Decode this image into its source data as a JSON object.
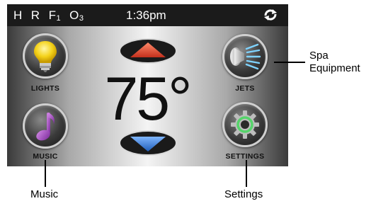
{
  "status_bar": {
    "indicators": [
      {
        "text": "H",
        "sub": ""
      },
      {
        "text": "R",
        "sub": ""
      },
      {
        "text": "F",
        "sub": "1"
      },
      {
        "text": "O",
        "sub": "3"
      }
    ],
    "time": "1:36pm",
    "sync_icon": "sync-icon"
  },
  "buttons": {
    "lights": {
      "label": "LIGHTS",
      "icon": "lightbulb-icon"
    },
    "music": {
      "label": "MUSIC",
      "icon": "music-note-icon"
    },
    "jets": {
      "label": "JETS",
      "icon": "jets-icon"
    },
    "settings": {
      "label": "SETTINGS",
      "icon": "gear-icon"
    }
  },
  "temperature": {
    "value": "75°"
  },
  "arrows": {
    "up": {
      "icon": "up-arrow-icon",
      "color": "#e0523a"
    },
    "down": {
      "icon": "down-arrow-icon",
      "color": "#3d7fd6"
    }
  },
  "callouts": {
    "spa_equipment": [
      "Spa",
      "Equipment"
    ],
    "music": "Music",
    "settings": "Settings"
  }
}
